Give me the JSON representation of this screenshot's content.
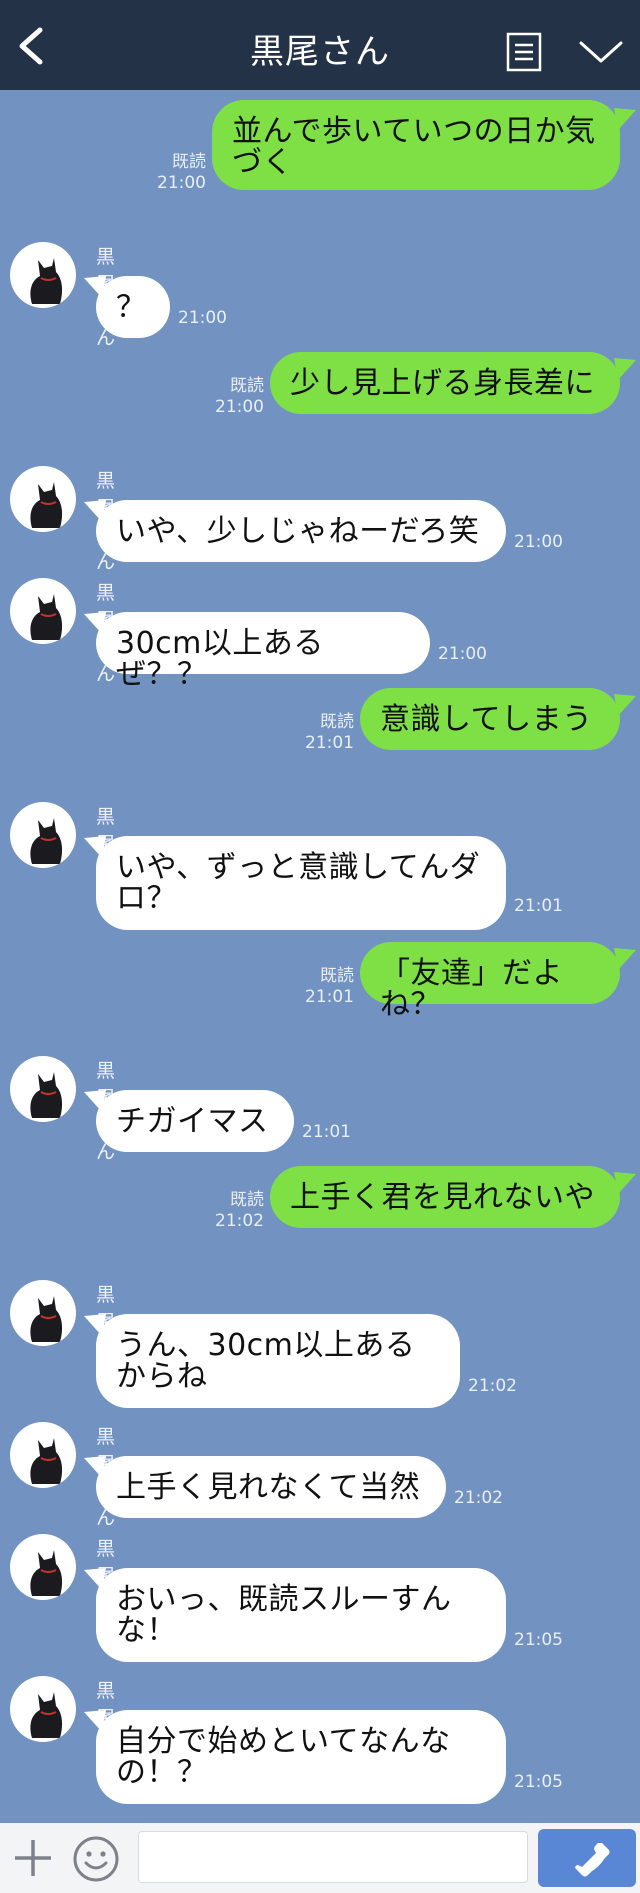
{
  "header": {
    "title": "黒尾さん",
    "background": "#243247"
  },
  "colors": {
    "chat_background": "#7293c2",
    "outgoing_bubble": "#7ee045",
    "incoming_bubble": "#ffffff",
    "call_button": "#5a86d6"
  },
  "messages": [
    {
      "dir": "out",
      "text": "並んで歩いていつの日か気づく",
      "read": "既読",
      "time": "21:00"
    },
    {
      "dir": "in",
      "sender": "黒尾さん",
      "text": "？",
      "time": "21:00"
    },
    {
      "dir": "out",
      "text": "少し見上げる身長差に",
      "read": "既読",
      "time": "21:00"
    },
    {
      "dir": "in",
      "sender": "黒尾さん",
      "text": "いや、少しじゃねーだろ笑",
      "time": "21:00"
    },
    {
      "dir": "in",
      "sender": "黒尾さん",
      "text": "30cm以上あるぜ？？",
      "time": "21:00"
    },
    {
      "dir": "out",
      "text": "意識してしまう",
      "read": "既読",
      "time": "21:01"
    },
    {
      "dir": "in",
      "sender": "黒尾さん",
      "text": "いや、ずっと意識してんダロ？",
      "time": "21:01"
    },
    {
      "dir": "out",
      "text": "「友達」だよね？",
      "read": "既読",
      "time": "21:01"
    },
    {
      "dir": "in",
      "sender": "黒尾さん",
      "text": "チガイマス",
      "time": "21:01"
    },
    {
      "dir": "out",
      "text": "上手く君を見れないや",
      "read": "既読",
      "time": "21:02"
    },
    {
      "dir": "in",
      "sender": "黒尾さん",
      "text": "うん、30cm以上あるからね",
      "time": "21:02"
    },
    {
      "dir": "in",
      "sender": "黒尾さん",
      "text": "上手く見れなくて当然",
      "time": "21:02"
    },
    {
      "dir": "in",
      "sender": "黒尾さん",
      "text": "おいっ、既読スルーすんな！",
      "time": "21:05"
    },
    {
      "dir": "in",
      "sender": "黒尾さん",
      "text": "自分で始めといてなんなの！？",
      "time": "21:05"
    }
  ],
  "input": {
    "placeholder": ""
  },
  "icons": {
    "back": "back-chevron-icon",
    "notes": "notes-icon",
    "menu": "chevron-down-icon",
    "plus": "plus-icon",
    "emoji": "smiley-icon",
    "call": "phone-icon",
    "avatar": "black-cat-avatar"
  }
}
